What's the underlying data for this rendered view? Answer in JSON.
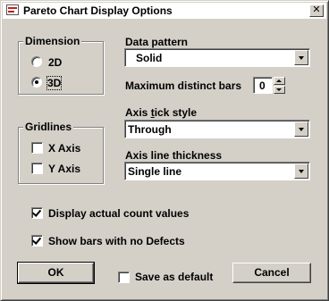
{
  "window": {
    "title": "Pareto Chart Display Options",
    "close_glyph": "✕"
  },
  "dimension": {
    "legend": "Dimension",
    "options": [
      {
        "label": "2D",
        "selected": false
      },
      {
        "label": "3D",
        "selected": true
      }
    ]
  },
  "gridlines": {
    "legend": "Gridlines",
    "options": [
      {
        "label": "X Axis",
        "checked": false
      },
      {
        "label": "Y Axis",
        "checked": false
      }
    ]
  },
  "data_pattern": {
    "label": "Data pattern",
    "value": "Solid"
  },
  "max_bars": {
    "label": "Maximum distinct bars",
    "value": "0"
  },
  "axis_tick_style": {
    "label_pre": "Axis ",
    "label_accel": "t",
    "label_post": "ick style",
    "value": "Through"
  },
  "axis_line_thickness": {
    "label": "Axis line thickness",
    "value": "Single line"
  },
  "options": {
    "display_counts": {
      "label": "Display actual count values",
      "checked": true
    },
    "show_no_defects": {
      "label": "Show bars with no Defects",
      "checked": true
    },
    "save_default": {
      "label": "Save as default",
      "checked": false
    }
  },
  "buttons": {
    "ok": "OK",
    "cancel": "Cancel"
  },
  "icons": {
    "app": "pareto-chart-icon",
    "close": "close-icon",
    "dropdown": "chevron-down-icon"
  }
}
